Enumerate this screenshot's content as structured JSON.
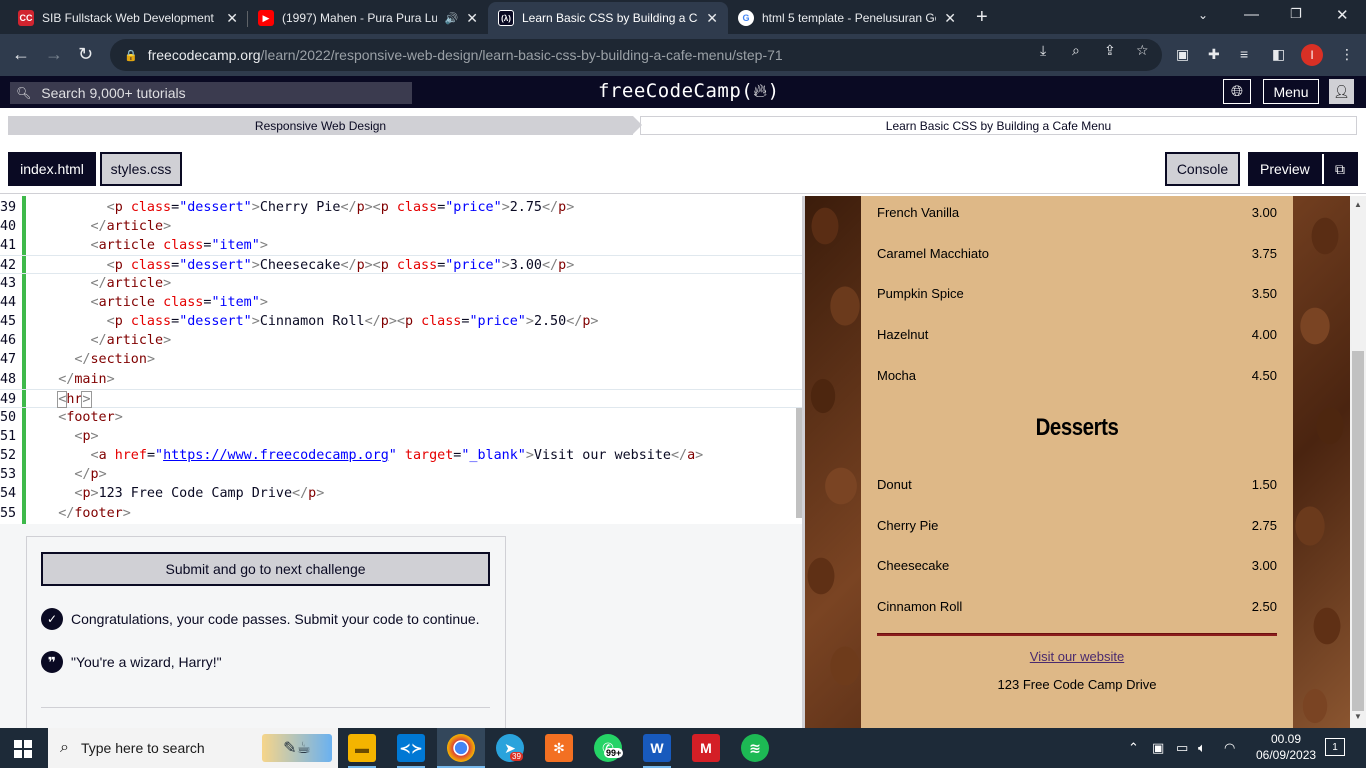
{
  "browser": {
    "tabs": [
      {
        "title": "SIB Fullstack Web Development |",
        "icon": "codecademy-icon"
      },
      {
        "title": "(1997) Mahen - Pura Pura Lu",
        "icon": "youtube-icon"
      },
      {
        "title": "Learn Basic CSS by Building a Caf",
        "icon": "freecodecamp-icon"
      },
      {
        "title": "html 5 template - Penelusuran Go",
        "icon": "google-icon"
      }
    ],
    "url_host": "freecodecamp.org",
    "url_path": "/learn/2022/responsive-web-design/learn-basic-css-by-building-a-cafe-menu/step-71",
    "profile_initial": "I"
  },
  "fcc": {
    "search_placeholder": "Search 9,000+ tutorials",
    "logo": "freeCodeCamp(🔥)",
    "logo_text": "freeCodeCamp(",
    "logo_end": ")",
    "menu_label": "Menu"
  },
  "breadcrumb": {
    "superblock": "Responsive Web Design",
    "block": "Learn Basic CSS by Building a Cafe Menu"
  },
  "editor_tabs": {
    "index": "index.html",
    "styles": "styles.css",
    "console": "Console",
    "preview": "Preview"
  },
  "code_lines": {
    "n39": "39",
    "n40": "40",
    "n41": "41",
    "n42": "42",
    "n43": "43",
    "n44": "44",
    "n45": "45",
    "n46": "46",
    "n47": "47",
    "n48": "48",
    "n49": "49",
    "n50": "50",
    "n51": "51",
    "n52": "52",
    "n53": "53",
    "n54": "54",
    "n55": "55"
  },
  "code": {
    "l39_text": "Cherry Pie",
    "l39_price": "2.75",
    "l42_text": "Cheesecake",
    "l42_price": "3.00",
    "l45_text": "Cinnamon Roll",
    "l45_price": "2.50",
    "l52_href": "https://www.freecodecamp.org",
    "l52_target": "_blank",
    "l52_text": "Visit our website",
    "l54_text": "123 Free Code Camp Drive"
  },
  "panel": {
    "submit": "Submit and go to next challenge",
    "pass_message": "Congratulations, your code passes. Submit your code to continue.",
    "quote": "\"You're a wizard, Harry!\""
  },
  "preview": {
    "coffee": [
      {
        "name": "French Vanilla",
        "price": "3.00"
      },
      {
        "name": "Caramel Macchiato",
        "price": "3.75"
      },
      {
        "name": "Pumpkin Spice",
        "price": "3.50"
      },
      {
        "name": "Hazelnut",
        "price": "4.00"
      },
      {
        "name": "Mocha",
        "price": "4.50"
      }
    ],
    "desserts_heading": "Desserts",
    "desserts": [
      {
        "name": "Donut",
        "price": "1.50"
      },
      {
        "name": "Cherry Pie",
        "price": "2.75"
      },
      {
        "name": "Cheesecake",
        "price": "3.00"
      },
      {
        "name": "Cinnamon Roll",
        "price": "2.50"
      }
    ],
    "link": "Visit our website",
    "address": "123 Free Code Camp Drive"
  },
  "taskbar": {
    "search": "Type here to search",
    "telegram_badge": "39",
    "whatsapp_badge": "99+",
    "time": "00.09",
    "date": "06/09/2023",
    "notification_count": "1"
  }
}
